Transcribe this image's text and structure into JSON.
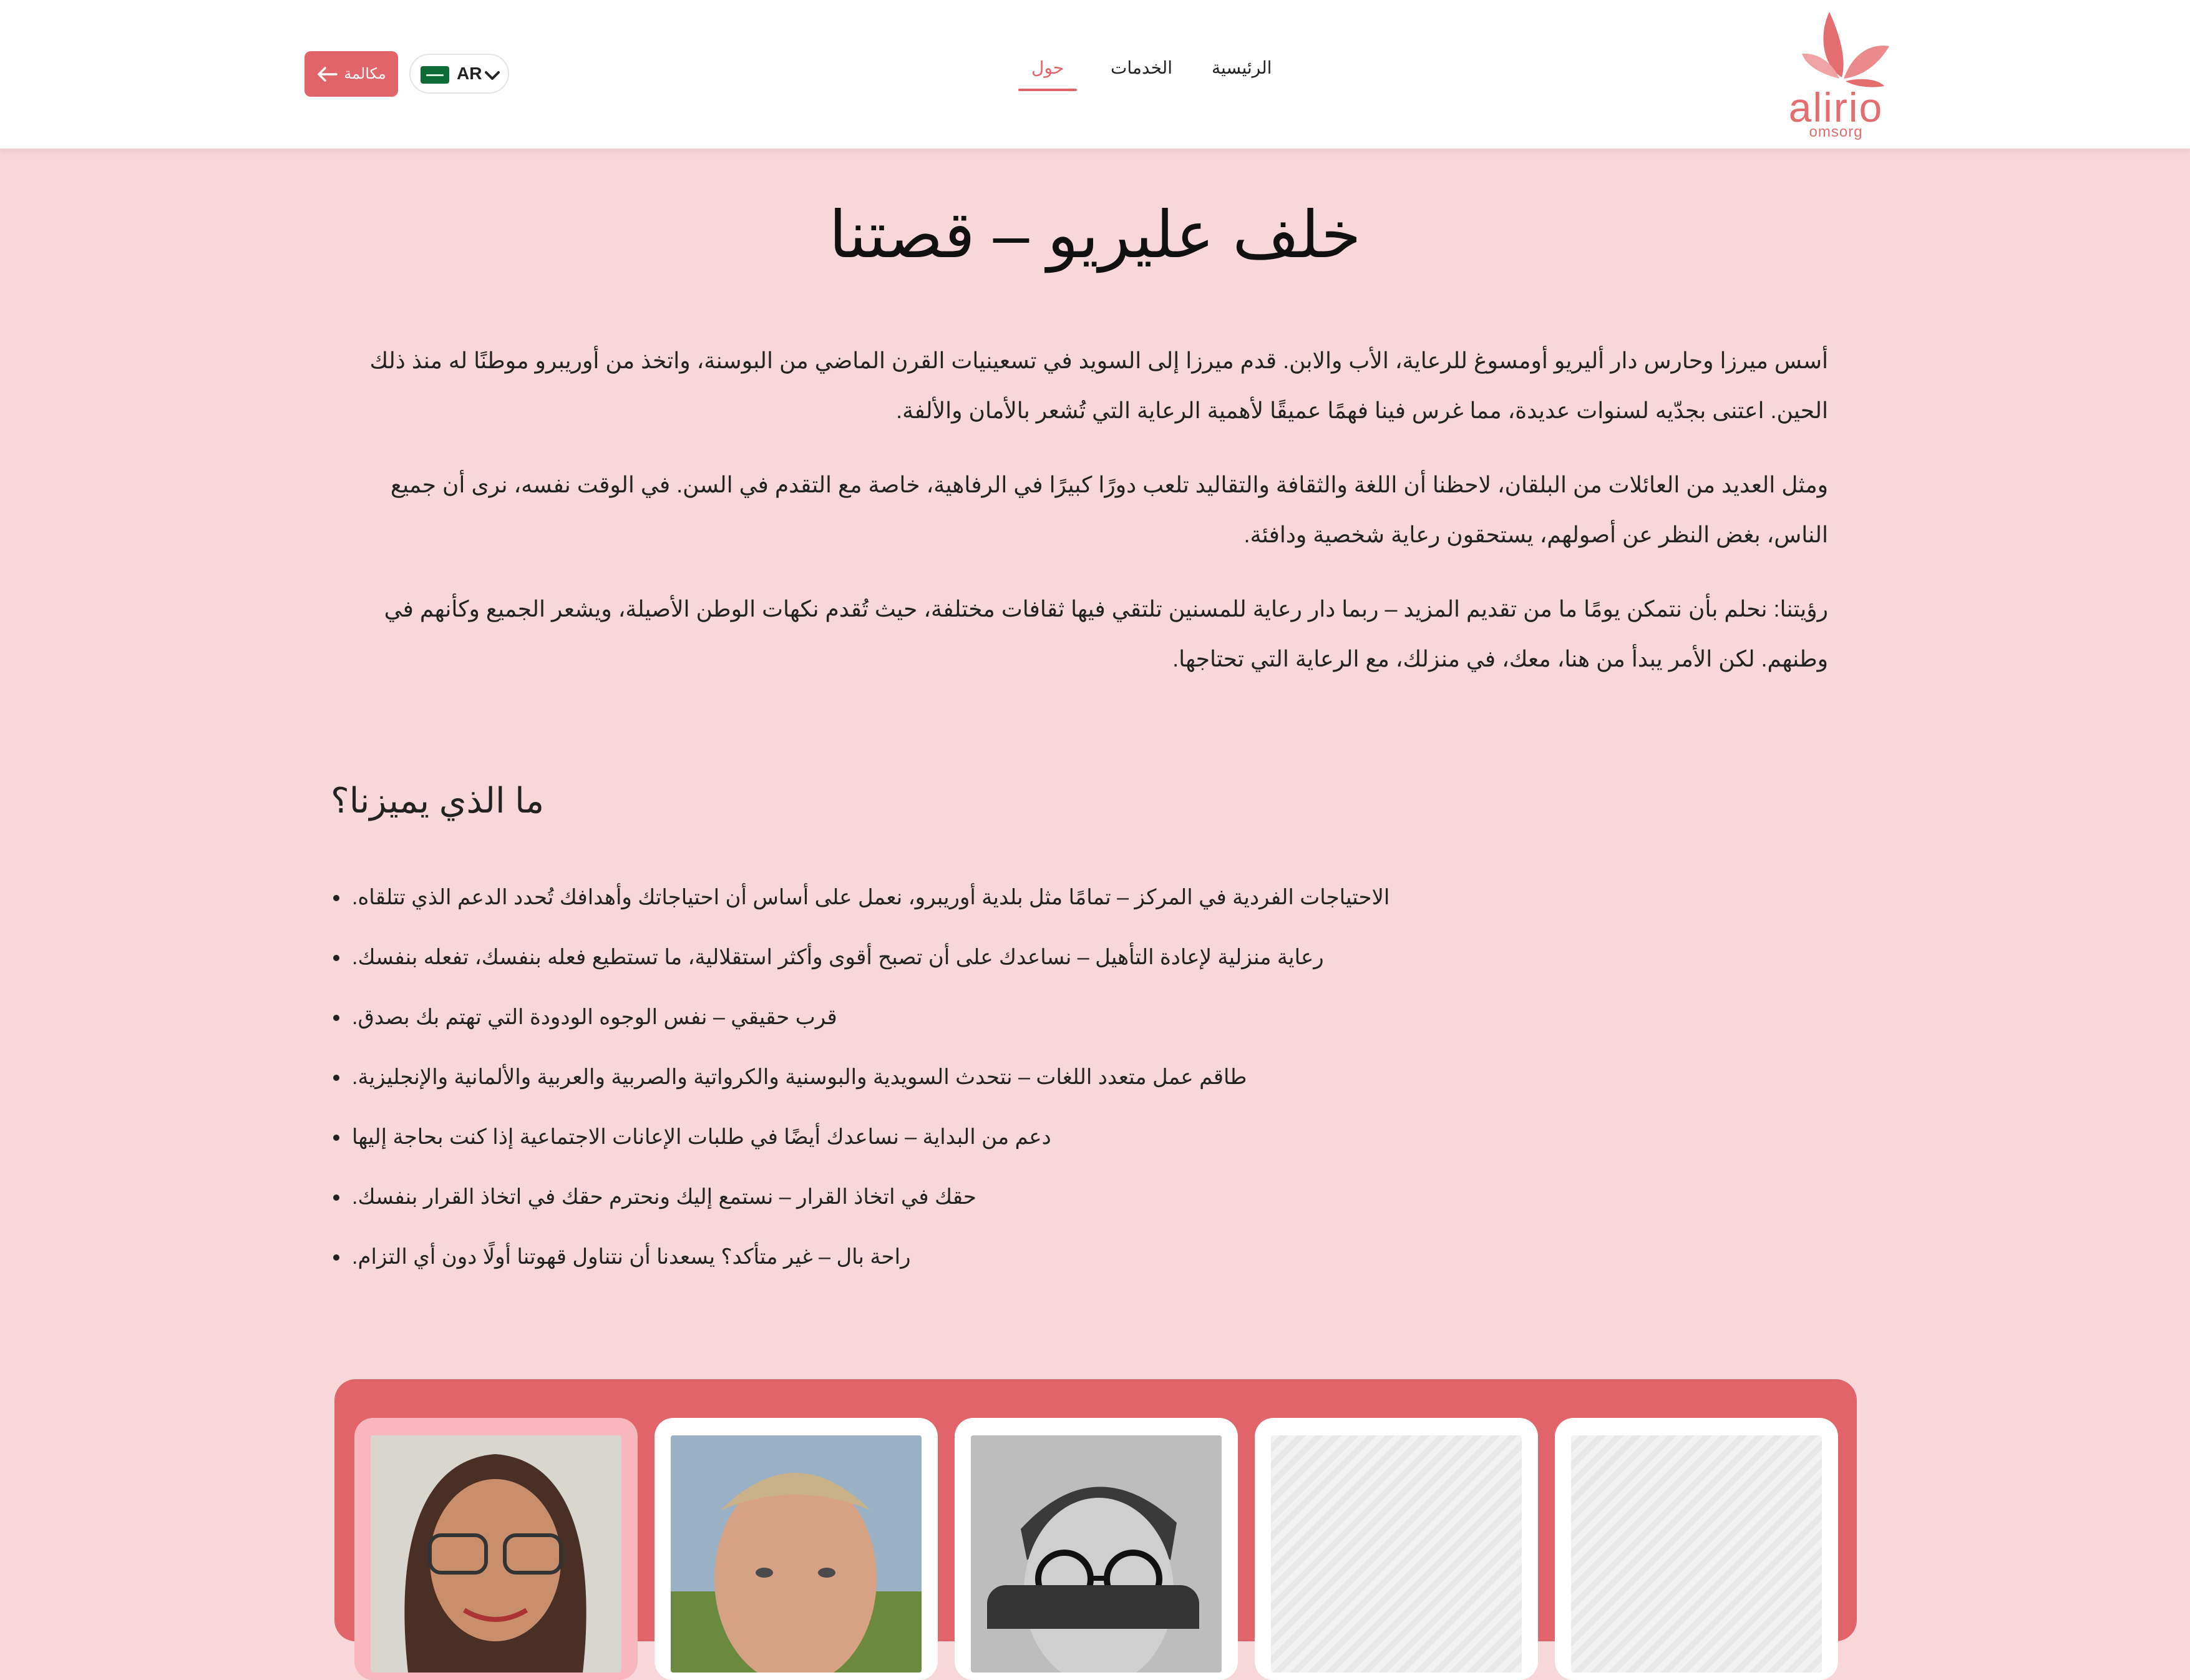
{
  "header": {
    "logo": {
      "word": "alirio",
      "sub": "omsorg",
      "brand_color": "#e46d70"
    },
    "nav": [
      {
        "label": "الرئيسية",
        "active": false
      },
      {
        "label": "الخدمات",
        "active": false
      },
      {
        "label": "حول",
        "active": true
      }
    ],
    "language": {
      "code": "AR",
      "flag_icon": "saudi-flag-icon"
    },
    "call_button": {
      "label": "مكالمة",
      "icon": "arrow-left-icon"
    }
  },
  "main": {
    "title": "خلف عليريو – قصتنا",
    "paragraphs": [
      "أسس ميرزا وحارس دار أليريو أومسوغ للرعاية، الأب والابن. قدم ميرزا إلى السويد في تسعينيات القرن الماضي من البوسنة، واتخذ من أوريبرو موطنًا له منذ ذلك الحين. اعتنى بجدّيه لسنوات عديدة، مما غرس فينا فهمًا عميقًا لأهمية الرعاية التي تُشعر بالأمان والألفة.",
      "ومثل العديد من العائلات من البلقان، لاحظنا أن اللغة والثقافة والتقاليد تلعب دورًا كبيرًا في الرفاهية، خاصة مع التقدم في السن. في الوقت نفسه، نرى أن جميع الناس، بغض النظر عن أصولهم، يستحقون رعاية شخصية ودافئة.",
      "رؤيتنا: نحلم بأن نتمكن يومًا ما من تقديم المزيد – ربما دار رعاية للمسنين تلتقي فيها ثقافات مختلفة، حيث تُقدم نكهات الوطن الأصيلة، ويشعر الجميع وكأنهم في وطنهم. لكن الأمر يبدأ من هنا، معك، في منزلك، مع الرعاية التي تحتاجها."
    ],
    "features_title": "ما الذي يميزنا؟",
    "features": [
      "الاحتياجات الفردية في المركز – تمامًا مثل بلدية أوريبرو، نعمل على أساس أن احتياجاتك وأهدافك تُحدد الدعم الذي تتلقاه.",
      "رعاية منزلية لإعادة التأهيل – نساعدك على أن تصبح أقوى وأكثر استقلالية، ما تستطيع فعله بنفسك، تفعله بنفسك.",
      "قرب حقيقي – نفس الوجوه الودودة التي تهتم بك بصدق.",
      "طاقم عمل متعدد اللغات – نتحدث السويدية والبوسنية والكرواتية والصربية والعربية والألمانية والإنجليزية.",
      "دعم من البداية – نساعدك أيضًا في طلبات الإعانات الاجتماعية إذا كنت بحاجة إليها",
      "حقك في اتخاذ القرار – نستمع إليك ونحترم حقك في اتخاذ القرار بنفسك.",
      "راحة بال – غير متأكد؟ يسعدنا أن نتناول قهوتنا أولًا دون أي التزام."
    ]
  },
  "team": {
    "accent": "#e06469",
    "cards": [
      {
        "photo": "woman-portrait"
      },
      {
        "photo": "man-portrait"
      },
      {
        "photo": "man-glasses-portrait"
      },
      {
        "photo": "placeholder"
      },
      {
        "photo": "placeholder"
      }
    ]
  }
}
